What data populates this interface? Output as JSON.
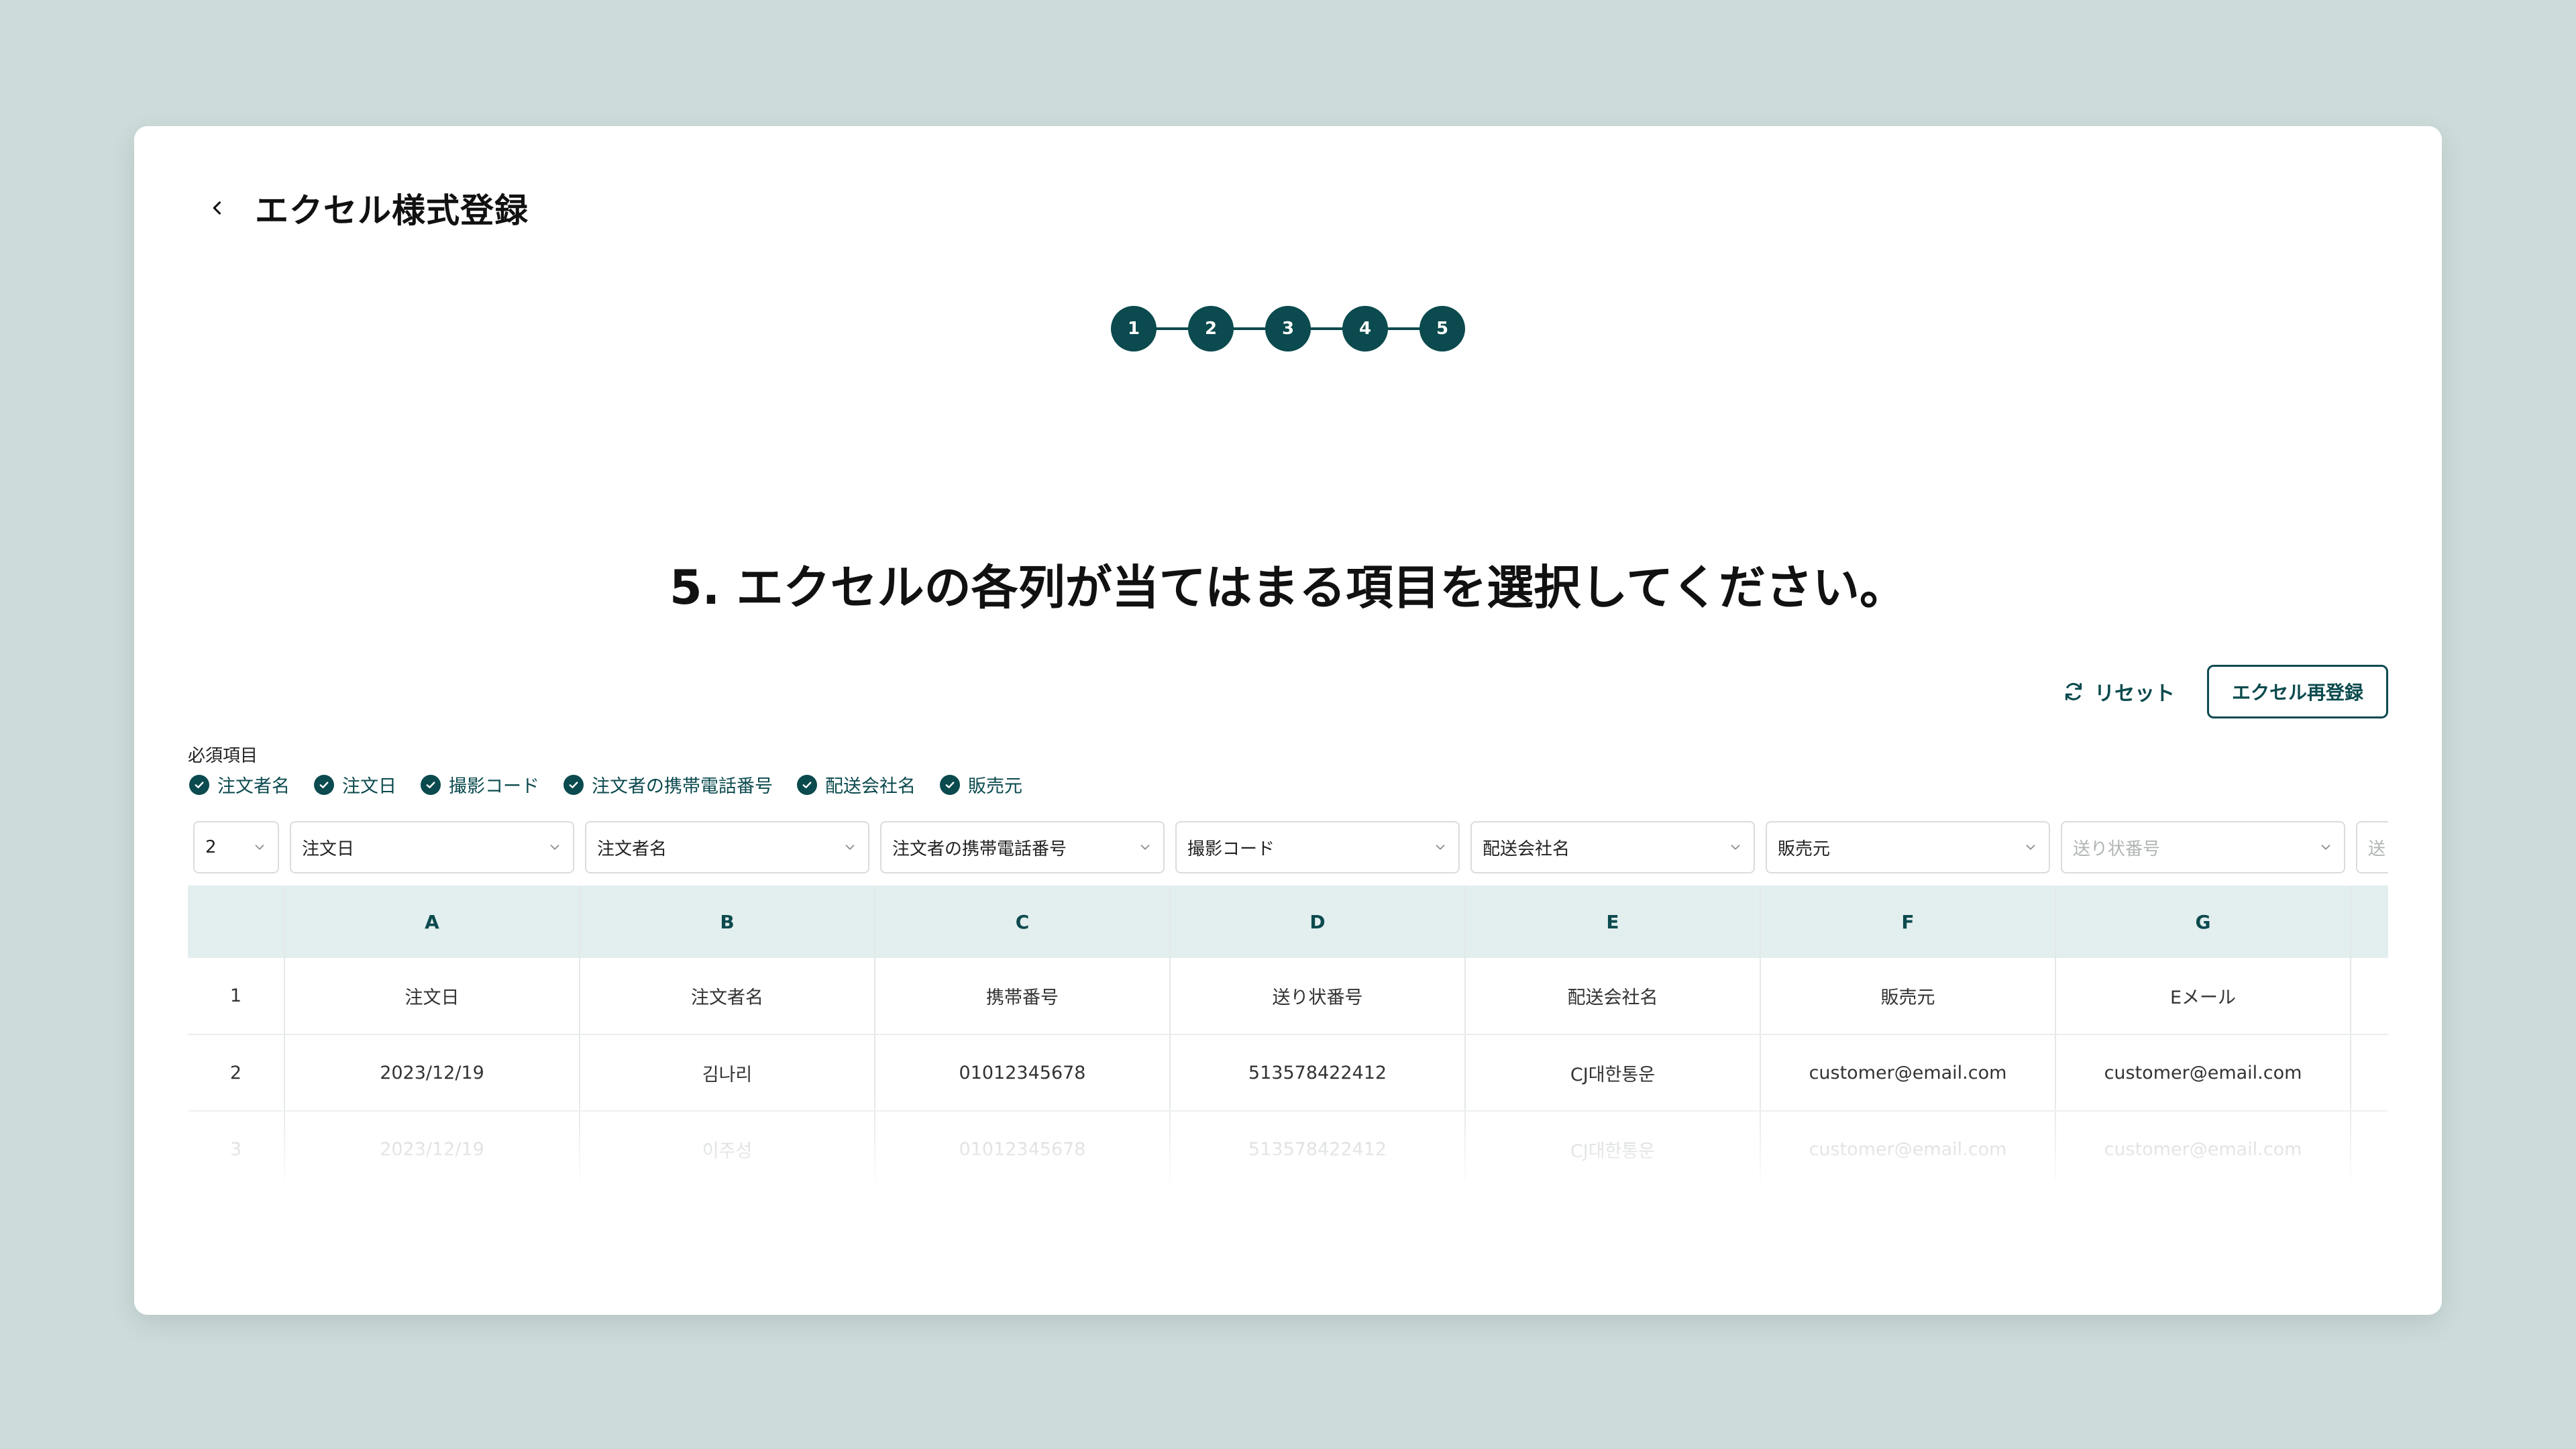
{
  "header": {
    "title": "エクセル様式登録"
  },
  "stepper": {
    "steps": [
      "1",
      "2",
      "3",
      "4",
      "5"
    ]
  },
  "question": "5. エクセルの各列が当てはまる項目を選択してください。",
  "actions": {
    "reset_label": "リセット",
    "reupload_label": "エクセル再登録"
  },
  "required": {
    "label": "必須項目",
    "items": [
      "注文者名",
      "注文日",
      "撮影コード",
      "注文者の携帯電話番号",
      "配送会社名",
      "販売元"
    ]
  },
  "selects": {
    "row_start": "2",
    "columns": [
      "注文日",
      "注文者名",
      "注文者の携帯電話番号",
      "撮影コード",
      "配送会社名",
      "販売元",
      "送り状番号",
      "送り状"
    ]
  },
  "table": {
    "headers": [
      "A",
      "B",
      "C",
      "D",
      "E",
      "F",
      "G"
    ],
    "rows": [
      {
        "index": "1",
        "cells": [
          "注文日",
          "注文者名",
          "携帯番号",
          "送り状番号",
          "配送会社名",
          "販売元",
          "Eメール"
        ]
      },
      {
        "index": "2",
        "cells": [
          "2023/12/19",
          "김나리",
          "01012345678",
          "513578422412",
          "CJ대한통운",
          "customer@email.com",
          "customer@email.com"
        ]
      },
      {
        "index": "3",
        "cells": [
          "2023/12/19",
          "이주성",
          "01012345678",
          "513578422412",
          "CJ대한통운",
          "customer@email.com",
          "customer@email.com"
        ]
      }
    ]
  },
  "colors": {
    "accent": "#0b4a4e",
    "header_bg": "#e3eeee",
    "page_bg": "#cddbdb"
  }
}
